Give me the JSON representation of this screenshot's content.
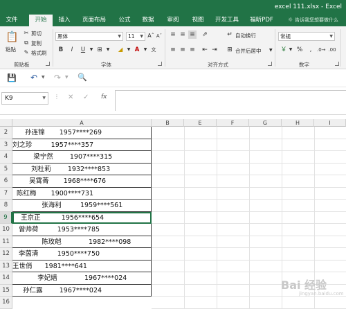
{
  "window": {
    "title": "excel    111.xlsx - Excel"
  },
  "tabs": [
    {
      "label": "文件",
      "active": false
    },
    {
      "label": "开始",
      "active": true
    },
    {
      "label": "插入",
      "active": false
    },
    {
      "label": "页面布局",
      "active": false
    },
    {
      "label": "公式",
      "active": false
    },
    {
      "label": "数据",
      "active": false
    },
    {
      "label": "审阅",
      "active": false
    },
    {
      "label": "视图",
      "active": false
    },
    {
      "label": "开发工具",
      "active": false
    },
    {
      "label": "福昕PDF",
      "active": false
    }
  ],
  "tell_me": "告诉我您想要做什么",
  "ribbon": {
    "clipboard": {
      "paste": "粘贴",
      "cut": "剪切",
      "copy": "复制",
      "format_painter": "格式刷",
      "group_label": "剪贴板"
    },
    "font": {
      "font_name": "黑体",
      "font_size": "11",
      "bold": "B",
      "italic": "I",
      "underline": "U",
      "group_label": "字体"
    },
    "alignment": {
      "wrap_text": "自动换行",
      "merge_center": "合并后居中",
      "group_label": "对齐方式"
    },
    "number": {
      "format": "常规",
      "percent": "%",
      "comma": ",",
      "group_label": "数字"
    }
  },
  "formula_bar": {
    "name_box": "K9",
    "cancel": "✕",
    "enter": "✓",
    "fx": "fx",
    "formula": ""
  },
  "columns": [
    "A",
    "B",
    "E",
    "F",
    "G",
    "H",
    "I"
  ],
  "rows": [
    {
      "num": "2",
      "text": "      孙连锦       1957****269"
    },
    {
      "num": "3",
      "text": "刘之珍         1957****357"
    },
    {
      "num": "4",
      "text": "          梁宁然        1907****315"
    },
    {
      "num": "5",
      "text": "         刘杜莉        1932****853"
    },
    {
      "num": "6",
      "text": "        吴霄菁       1968****676"
    },
    {
      "num": "7",
      "text": "  陈红梅       1900****731"
    },
    {
      "num": "8",
      "text": "              张海利         1959****561"
    },
    {
      "num": "9",
      "text": "    王京正          1956****654"
    },
    {
      "num": "10",
      "text": "   曾帅荷         1953****785"
    },
    {
      "num": "11",
      "text": "              陈玫皑             1982****098"
    },
    {
      "num": "12",
      "text": "   李茵清         1950****750"
    },
    {
      "num": "13",
      "text": "王世俏      1981****641"
    },
    {
      "num": "14",
      "text": "            李妃嫱             1967****024"
    },
    {
      "num": "15",
      "text": "     孙仁露        1967****024"
    },
    {
      "num": "16",
      "text": ""
    }
  ],
  "selected_row": "9",
  "watermark": {
    "brand": "Bai 经验",
    "url": "jingyan.baidu.com"
  }
}
